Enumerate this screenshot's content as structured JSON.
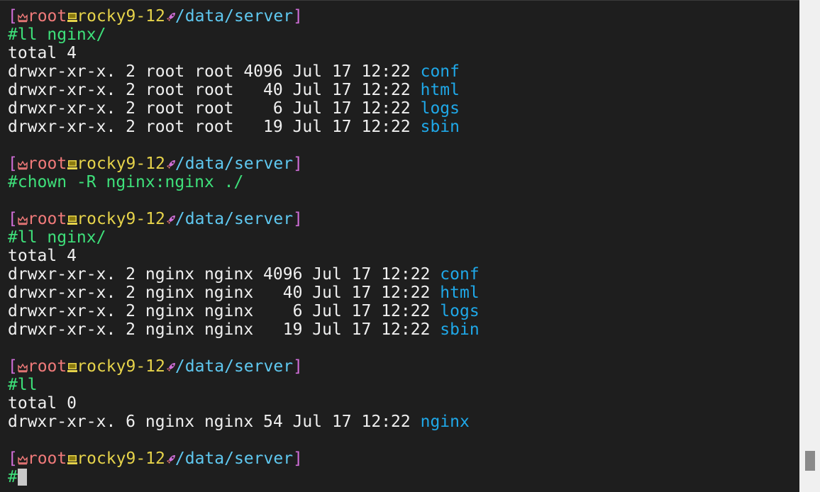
{
  "prompt": {
    "open_bracket": "[",
    "user": "root",
    "host": "rocky9-12",
    "path": "/data/server",
    "close_bracket": "]",
    "user_icon": "crown-icon",
    "host_icon": "computer-icon",
    "path_icon": "rocket-icon"
  },
  "colors": {
    "bracket": "#d06ed8",
    "user": "#f07a7a",
    "host": "#e6d34a",
    "path": "#5fc8f0",
    "command": "#3ee07a",
    "directory": "#1fa8e8",
    "output": "#f0f0f0",
    "background": "#1e1e1e"
  },
  "blocks": [
    {
      "command": "#ll nginx/",
      "output": [
        {
          "text": "total 4"
        },
        {
          "text": "drwxr-xr-x. 2 root root 4096 Jul 17 12:22 ",
          "dir": "conf"
        },
        {
          "text": "drwxr-xr-x. 2 root root   40 Jul 17 12:22 ",
          "dir": "html"
        },
        {
          "text": "drwxr-xr-x. 2 root root    6 Jul 17 12:22 ",
          "dir": "logs"
        },
        {
          "text": "drwxr-xr-x. 2 root root   19 Jul 17 12:22 ",
          "dir": "sbin"
        }
      ]
    },
    {
      "command": "#chown -R nginx:nginx ./",
      "output": []
    },
    {
      "command": "#ll nginx/",
      "output": [
        {
          "text": "total 4"
        },
        {
          "text": "drwxr-xr-x. 2 nginx nginx 4096 Jul 17 12:22 ",
          "dir": "conf"
        },
        {
          "text": "drwxr-xr-x. 2 nginx nginx   40 Jul 17 12:22 ",
          "dir": "html"
        },
        {
          "text": "drwxr-xr-x. 2 nginx nginx    6 Jul 17 12:22 ",
          "dir": "logs"
        },
        {
          "text": "drwxr-xr-x. 2 nginx nginx   19 Jul 17 12:22 ",
          "dir": "sbin"
        }
      ]
    },
    {
      "command": "#ll",
      "output": [
        {
          "text": "total 0"
        },
        {
          "text": "drwxr-xr-x. 6 nginx nginx 54 Jul 17 12:22 ",
          "dir": "nginx"
        }
      ]
    }
  ],
  "current_input": "#"
}
